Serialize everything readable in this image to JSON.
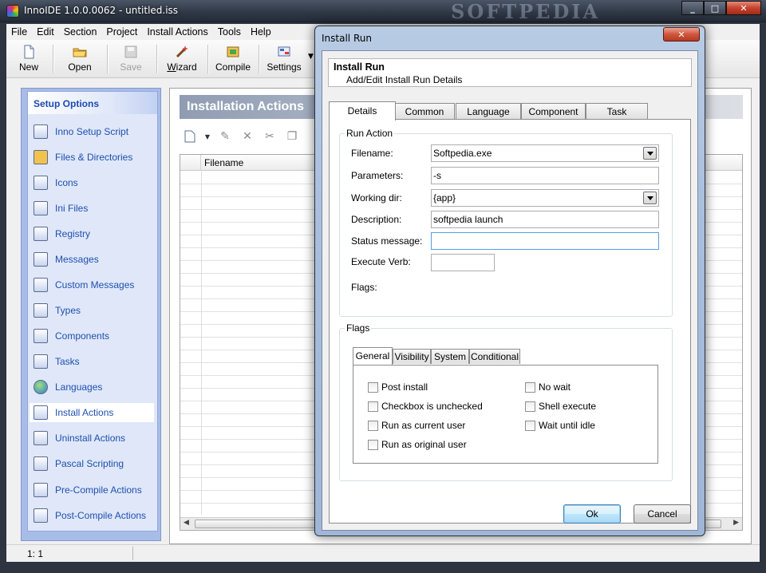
{
  "window": {
    "title": "InnoIDE 1.0.0.0062 - untitled.iss",
    "watermark": "SOFTPEDIA",
    "min": "_",
    "max": "□",
    "close": "✕"
  },
  "menu": [
    "File",
    "Edit",
    "Section",
    "Project",
    "Install Actions",
    "Tools",
    "Help"
  ],
  "toolbar": {
    "new": "New",
    "open": "Open",
    "save": "Save",
    "wizard": "Wizard",
    "compile": "Compile",
    "settings": "Settings"
  },
  "sidebar": {
    "title": "Setup Options",
    "items": [
      {
        "label": "Inno Setup Script",
        "icon": "script-icon"
      },
      {
        "label": "Files & Directories",
        "icon": "folder-icon"
      },
      {
        "label": "Icons",
        "icon": "icons-icon"
      },
      {
        "label": "Ini Files",
        "icon": "ini-file-icon"
      },
      {
        "label": "Registry",
        "icon": "registry-icon"
      },
      {
        "label": "Messages",
        "icon": "info-icon"
      },
      {
        "label": "Custom Messages",
        "icon": "info-icon"
      },
      {
        "label": "Types",
        "icon": "types-icon"
      },
      {
        "label": "Components",
        "icon": "components-icon"
      },
      {
        "label": "Tasks",
        "icon": "tasks-icon"
      },
      {
        "label": "Languages",
        "icon": "globe-icon"
      },
      {
        "label": "Install Actions",
        "icon": "install-actions-icon"
      },
      {
        "label": "Uninstall Actions",
        "icon": "uninstall-actions-icon"
      },
      {
        "label": "Pascal Scripting",
        "icon": "pascal-script-icon"
      },
      {
        "label": "Pre-Compile Actions",
        "icon": "pre-compile-icon"
      },
      {
        "label": "Post-Compile Actions",
        "icon": "post-compile-icon"
      }
    ],
    "selected_index": 11
  },
  "panel": {
    "title": "Installation Actions",
    "column": "Filename"
  },
  "status": {
    "position": "1:  1"
  },
  "dialog": {
    "title": "Install Run",
    "close": "✕",
    "header_title": "Install Run",
    "header_subtitle": "Add/Edit Install Run Details",
    "tabs": [
      "Details",
      "Common",
      "Language",
      "Component",
      "Task"
    ],
    "run_action": {
      "group": "Run Action",
      "filename_label": "Filename:",
      "filename": "Softpedia.exe",
      "parameters_label": "Parameters:",
      "parameters": "-s",
      "working_dir_label": "Working dir:",
      "working_dir": "{app}",
      "description_label": "Description:",
      "description": "softpedia launch",
      "status_label": "Status message:",
      "status": "",
      "verb_label": "Execute Verb:",
      "verb": "",
      "flags_label": "Flags:"
    },
    "flags": {
      "group": "Flags",
      "tabs": [
        "General",
        "Visibility",
        "System",
        "Conditional"
      ],
      "left": [
        "Post install",
        "Checkbox is unchecked",
        "Run as current user",
        "Run as original user"
      ],
      "right": [
        "No wait",
        "Shell execute",
        "Wait until idle"
      ]
    },
    "ok": "Ok",
    "cancel": "Cancel"
  }
}
